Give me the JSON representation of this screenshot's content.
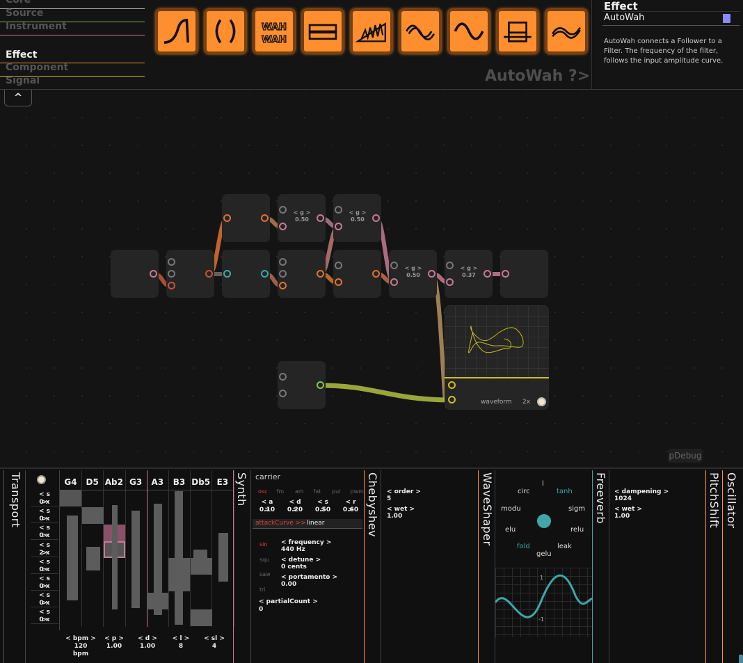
{
  "categories": [
    "Core",
    "Source",
    "Instrument",
    "Effect",
    "Component",
    "Signal"
  ],
  "active_category": "Effect",
  "effect_tiles": [
    "autofilter-icon",
    "parens-icon",
    "autowah-icon",
    "bitcrusher-icon",
    "chebyshev-icon",
    "chorus-icon",
    "sine-icon",
    "pitchshift-icon",
    "distortion-icon"
  ],
  "palette_title": "AutoWah ?>",
  "collapse_label": "^",
  "info": {
    "category": "Effect",
    "name": "AutoWah",
    "description": "AutoWah connects a Follower to a Filter. The frequency of the filter, follows the input amplitude curve."
  },
  "graph": {
    "gain_labels": [
      "< g >",
      "0.50",
      "< g >",
      "0.50",
      "< g >",
      "0.50",
      "< g >",
      "0.37"
    ]
  },
  "scope": {
    "label": "waveform",
    "zoom": "2x"
  },
  "pdebug_label": "pDebug",
  "transport": {
    "title": "Transport",
    "steps": [
      {
        "label": "< s >",
        "value": "0 x"
      },
      {
        "label": "< s >",
        "value": "0 x"
      },
      {
        "label": "< s >",
        "value": "0 x"
      },
      {
        "label": "< s >",
        "value": "2 x"
      },
      {
        "label": "< s >",
        "value": "0 x"
      },
      {
        "label": "< s >",
        "value": "0 x"
      },
      {
        "label": "< s >",
        "value": "0 x"
      },
      {
        "label": "< s >",
        "value": "0 x"
      }
    ]
  },
  "sequencer": {
    "notes": [
      "G4",
      "D5",
      "Ab2",
      "G3",
      "A3",
      "B3",
      "Db5",
      "E3"
    ],
    "params": [
      {
        "label": "< bpm >",
        "value": "120 bpm"
      },
      {
        "label": "< p >",
        "value": "1.00"
      },
      {
        "label": "< d >",
        "value": "1.00"
      },
      {
        "label": "< l >",
        "value": "8"
      },
      {
        "label": "< sl >",
        "value": "4"
      }
    ]
  },
  "synth": {
    "title": "Synth",
    "header": "carrier",
    "tabs": [
      "osc",
      "fm",
      "am",
      "fat",
      "pul",
      "pwm"
    ],
    "envelope": [
      {
        "label": "< a >",
        "value": "0.10"
      },
      {
        "label": "< d >",
        "value": "0.20"
      },
      {
        "label": "< s >",
        "value": "0.50"
      },
      {
        "label": "< r >",
        "value": "0.60"
      }
    ],
    "attack_curve_label": "attackCurve >>",
    "attack_curve_value": "linear",
    "wave_types": [
      "sin",
      "squ",
      "saw",
      "tri"
    ],
    "osc_params": [
      {
        "label": "< frequency >",
        "value": "440 Hz"
      },
      {
        "label": "< detune >",
        "value": "0 cents"
      },
      {
        "label": "< portamento >",
        "value": "0.00"
      }
    ],
    "partial_label": "< partialCount >",
    "partial_value": "0"
  },
  "chebyshev": {
    "title": "Chebyshev",
    "params": [
      {
        "label": "< order >",
        "value": "5"
      },
      {
        "label": "< wet >",
        "value": "1.00"
      }
    ]
  },
  "waveshaper": {
    "title": "WaveShaper",
    "functions": [
      "l",
      "circ",
      "tanh",
      "modu",
      "sigm",
      "elu",
      "relu",
      "fold",
      "leak",
      "gelu"
    ],
    "axis": [
      "1",
      "-1"
    ]
  },
  "freeverb": {
    "title": "Freeverb",
    "params": [
      {
        "label": "< dampening >",
        "value": "1024"
      },
      {
        "label": "< wet >",
        "value": "1.00"
      }
    ]
  },
  "pitchshift": {
    "title": "PitchShift"
  },
  "oscillator": {
    "title": "Oscillator"
  },
  "colors": {
    "accent": "#ff8f2e",
    "pink": "#c77a93",
    "teal": "#3fa7a8",
    "yellow": "#d0c020",
    "green": "#8dbf5a"
  }
}
